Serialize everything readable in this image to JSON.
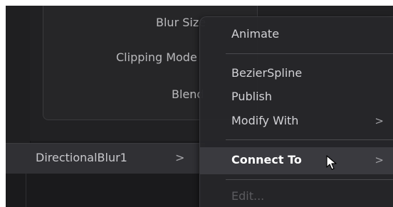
{
  "inspector": {
    "params": [
      {
        "label": "Blur Size"
      },
      {
        "label": "Clipping Mode"
      },
      {
        "label": "Blend"
      }
    ]
  },
  "tool_row": {
    "name": "DirectionalBlur1",
    "chevron": ">"
  },
  "context_menu": {
    "items": [
      {
        "label": "Animate",
        "submenu": false,
        "state": "normal"
      },
      {
        "label": "BezierSpline",
        "submenu": false,
        "state": "normal"
      },
      {
        "label": "Publish",
        "submenu": false,
        "state": "normal"
      },
      {
        "label": "Modify With",
        "submenu": true,
        "arrow": ">",
        "state": "normal"
      },
      {
        "label": "Connect To",
        "submenu": true,
        "arrow": ">",
        "state": "highlighted"
      },
      {
        "label": "Edit...",
        "submenu": false,
        "state": "disabled"
      }
    ]
  },
  "icons": {
    "cursor": "mouse-pointer-icon"
  },
  "colors": {
    "background": "#1b1b1d",
    "menu_bg": "#262629",
    "highlight_bg": "#3a3a3f",
    "text": "#d2d2d6",
    "disabled_text": "#5b5b5f"
  }
}
